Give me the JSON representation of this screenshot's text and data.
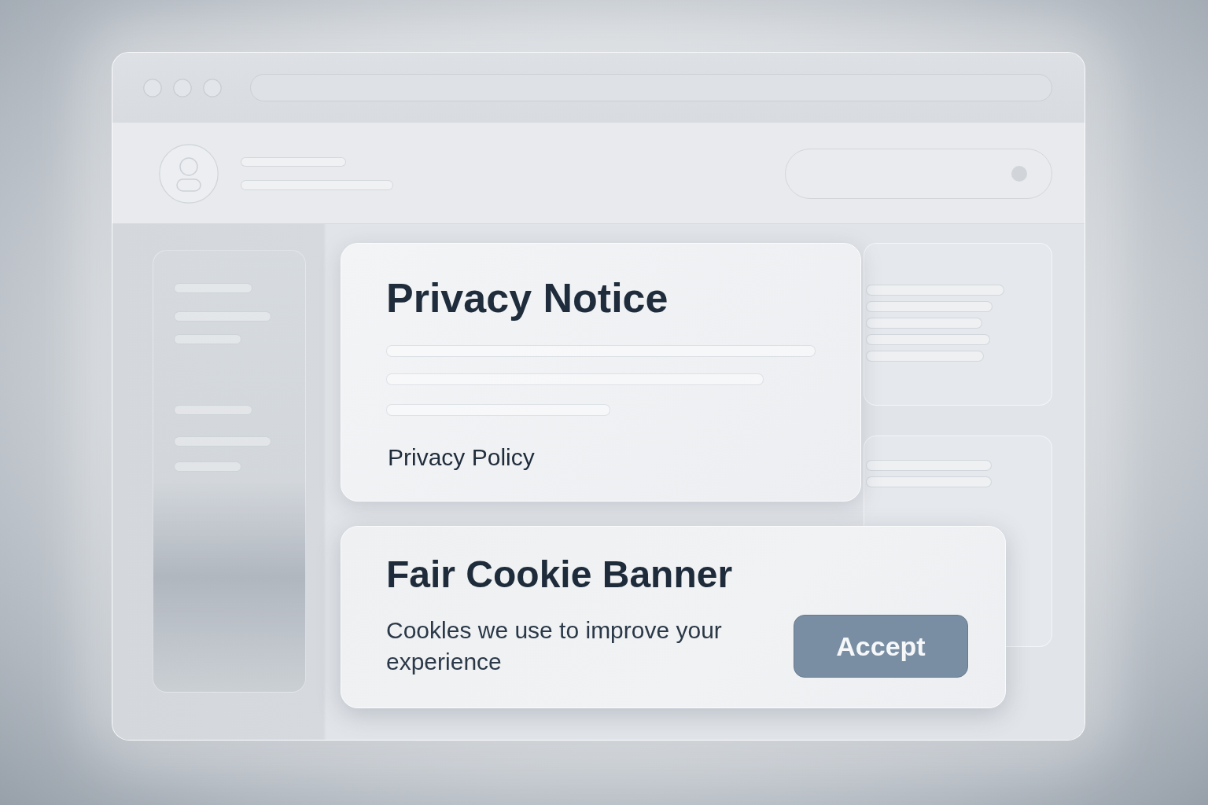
{
  "privacy_notice": {
    "title": "Privacy Notice",
    "link": "Privacy Policy"
  },
  "cookie_banner": {
    "title": "Fair Cookie Banner",
    "text": "Cookles we use to improve your experience",
    "button": "Accept"
  }
}
